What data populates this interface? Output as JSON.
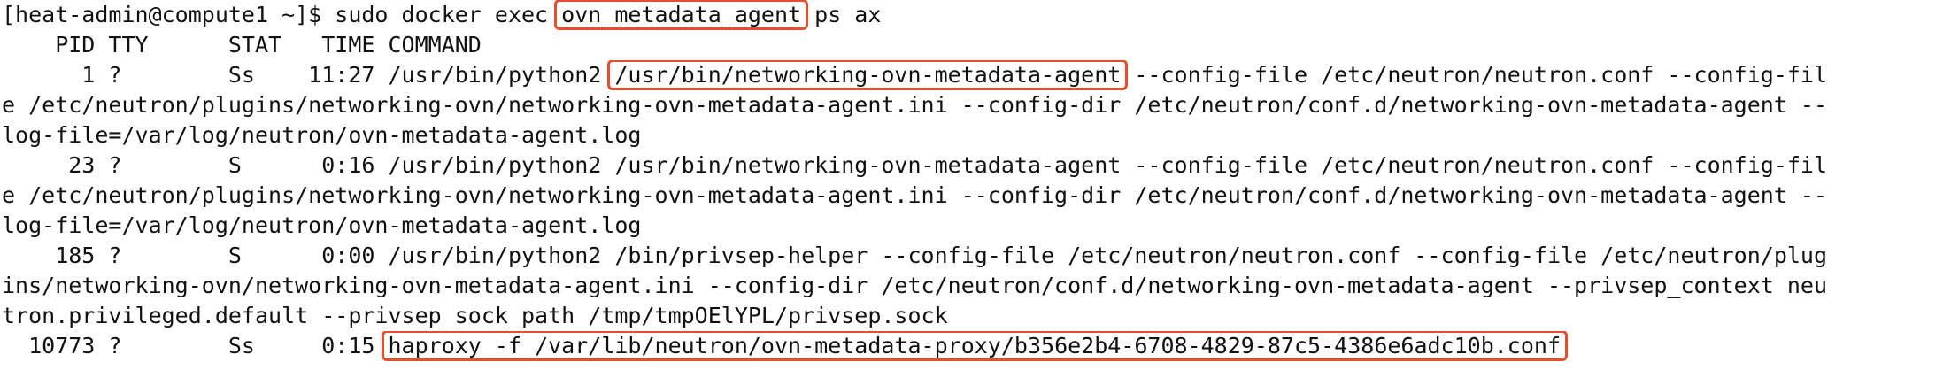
{
  "terminal": {
    "lines": [
      {
        "segments": [
          {
            "text": "[heat-admin@compute1 ~]$ sudo docker exec "
          },
          {
            "text": "ovn_metadata_agent",
            "highlight": true
          },
          {
            "text": " ps ax"
          }
        ]
      },
      {
        "segments": [
          {
            "text": "    PID TTY      STAT   TIME COMMAND"
          }
        ]
      },
      {
        "segments": [
          {
            "text": "      1 ?        Ss    11:27 /usr/bin/python2 "
          },
          {
            "text": "/usr/bin/networking-ovn-metadata-agent",
            "highlight": true
          },
          {
            "text": " --config-file /etc/neutron/neutron.conf --config-fil"
          }
        ]
      },
      {
        "segments": [
          {
            "text": "e /etc/neutron/plugins/networking-ovn/networking-ovn-metadata-agent.ini --config-dir /etc/neutron/conf.d/networking-ovn-metadata-agent --"
          }
        ]
      },
      {
        "segments": [
          {
            "text": "log-file=/var/log/neutron/ovn-metadata-agent.log"
          }
        ]
      },
      {
        "segments": [
          {
            "text": "     23 ?        S      0:16 /usr/bin/python2 /usr/bin/networking-ovn-metadata-agent --config-file /etc/neutron/neutron.conf --config-fil"
          }
        ]
      },
      {
        "segments": [
          {
            "text": "e /etc/neutron/plugins/networking-ovn/networking-ovn-metadata-agent.ini --config-dir /etc/neutron/conf.d/networking-ovn-metadata-agent --"
          }
        ]
      },
      {
        "segments": [
          {
            "text": "log-file=/var/log/neutron/ovn-metadata-agent.log"
          }
        ]
      },
      {
        "segments": [
          {
            "text": "    185 ?        S      0:00 /usr/bin/python2 /bin/privsep-helper --config-file /etc/neutron/neutron.conf --config-file /etc/neutron/plug"
          }
        ]
      },
      {
        "segments": [
          {
            "text": "ins/networking-ovn/networking-ovn-metadata-agent.ini --config-dir /etc/neutron/conf.d/networking-ovn-metadata-agent --privsep_context neu"
          }
        ]
      },
      {
        "segments": [
          {
            "text": "tron.privileged.default --privsep_sock_path /tmp/tmpOElYPL/privsep.sock"
          }
        ]
      },
      {
        "segments": [
          {
            "text": "  10773 ?        Ss     0:15 "
          },
          {
            "text": "haproxy -f /var/lib/neutron/ovn-metadata-proxy/b356e2b4-6708-4829-87c5-4386e6adc10b.conf",
            "highlight": true
          }
        ]
      }
    ]
  },
  "colors": {
    "highlight_border": "#e2502d",
    "text": "#111111",
    "background": "#ffffff"
  }
}
